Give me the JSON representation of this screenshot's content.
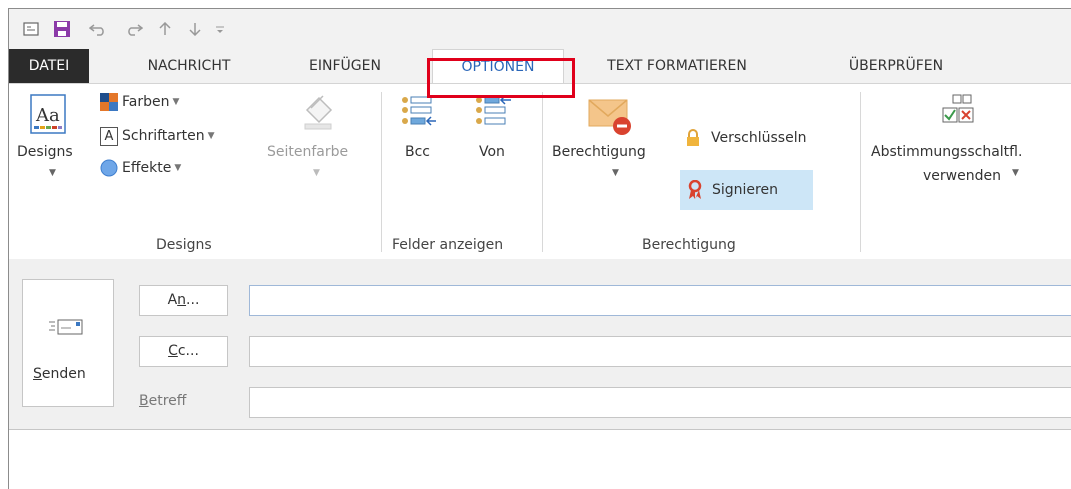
{
  "quick_access": {
    "icons": [
      "mail-icon",
      "save-icon",
      "undo-icon",
      "redo-icon",
      "up-arrow-icon",
      "down-arrow-icon",
      "customize-icon"
    ]
  },
  "tabs": {
    "file": "DATEI",
    "message": "NACHRICHT",
    "insert": "EINFÜGEN",
    "options": "OPTIONEN",
    "format": "TEXT FORMATIEREN",
    "review": "ÜBERPRÜFEN"
  },
  "ribbon": {
    "designs": {
      "designs_button": "Designs",
      "colors": "Farben",
      "fonts": "Schriftarten",
      "effects": "Effekte",
      "page_color": "Seitenfarbe",
      "group_label": "Designs"
    },
    "fields": {
      "bcc": "Bcc",
      "from": "Von",
      "group_label": "Felder anzeigen"
    },
    "permission": {
      "permission_button": "Berechtigung",
      "encrypt": "Verschlüsseln",
      "sign": "Signieren",
      "group_label": "Berechtigung"
    },
    "voting": {
      "line1": "Abstimmungsschaltfl.",
      "line2": "verwenden"
    }
  },
  "compose": {
    "send_rest": "enden",
    "to_rest": "...",
    "cc_rest": "c...",
    "subject_rest": "etreff"
  },
  "colors": {
    "accent": "#2a66b8",
    "highlight_box": "#e0001b",
    "file_tab_bg": "#2b2b2b",
    "selected_button_bg": "#cde6f7"
  }
}
